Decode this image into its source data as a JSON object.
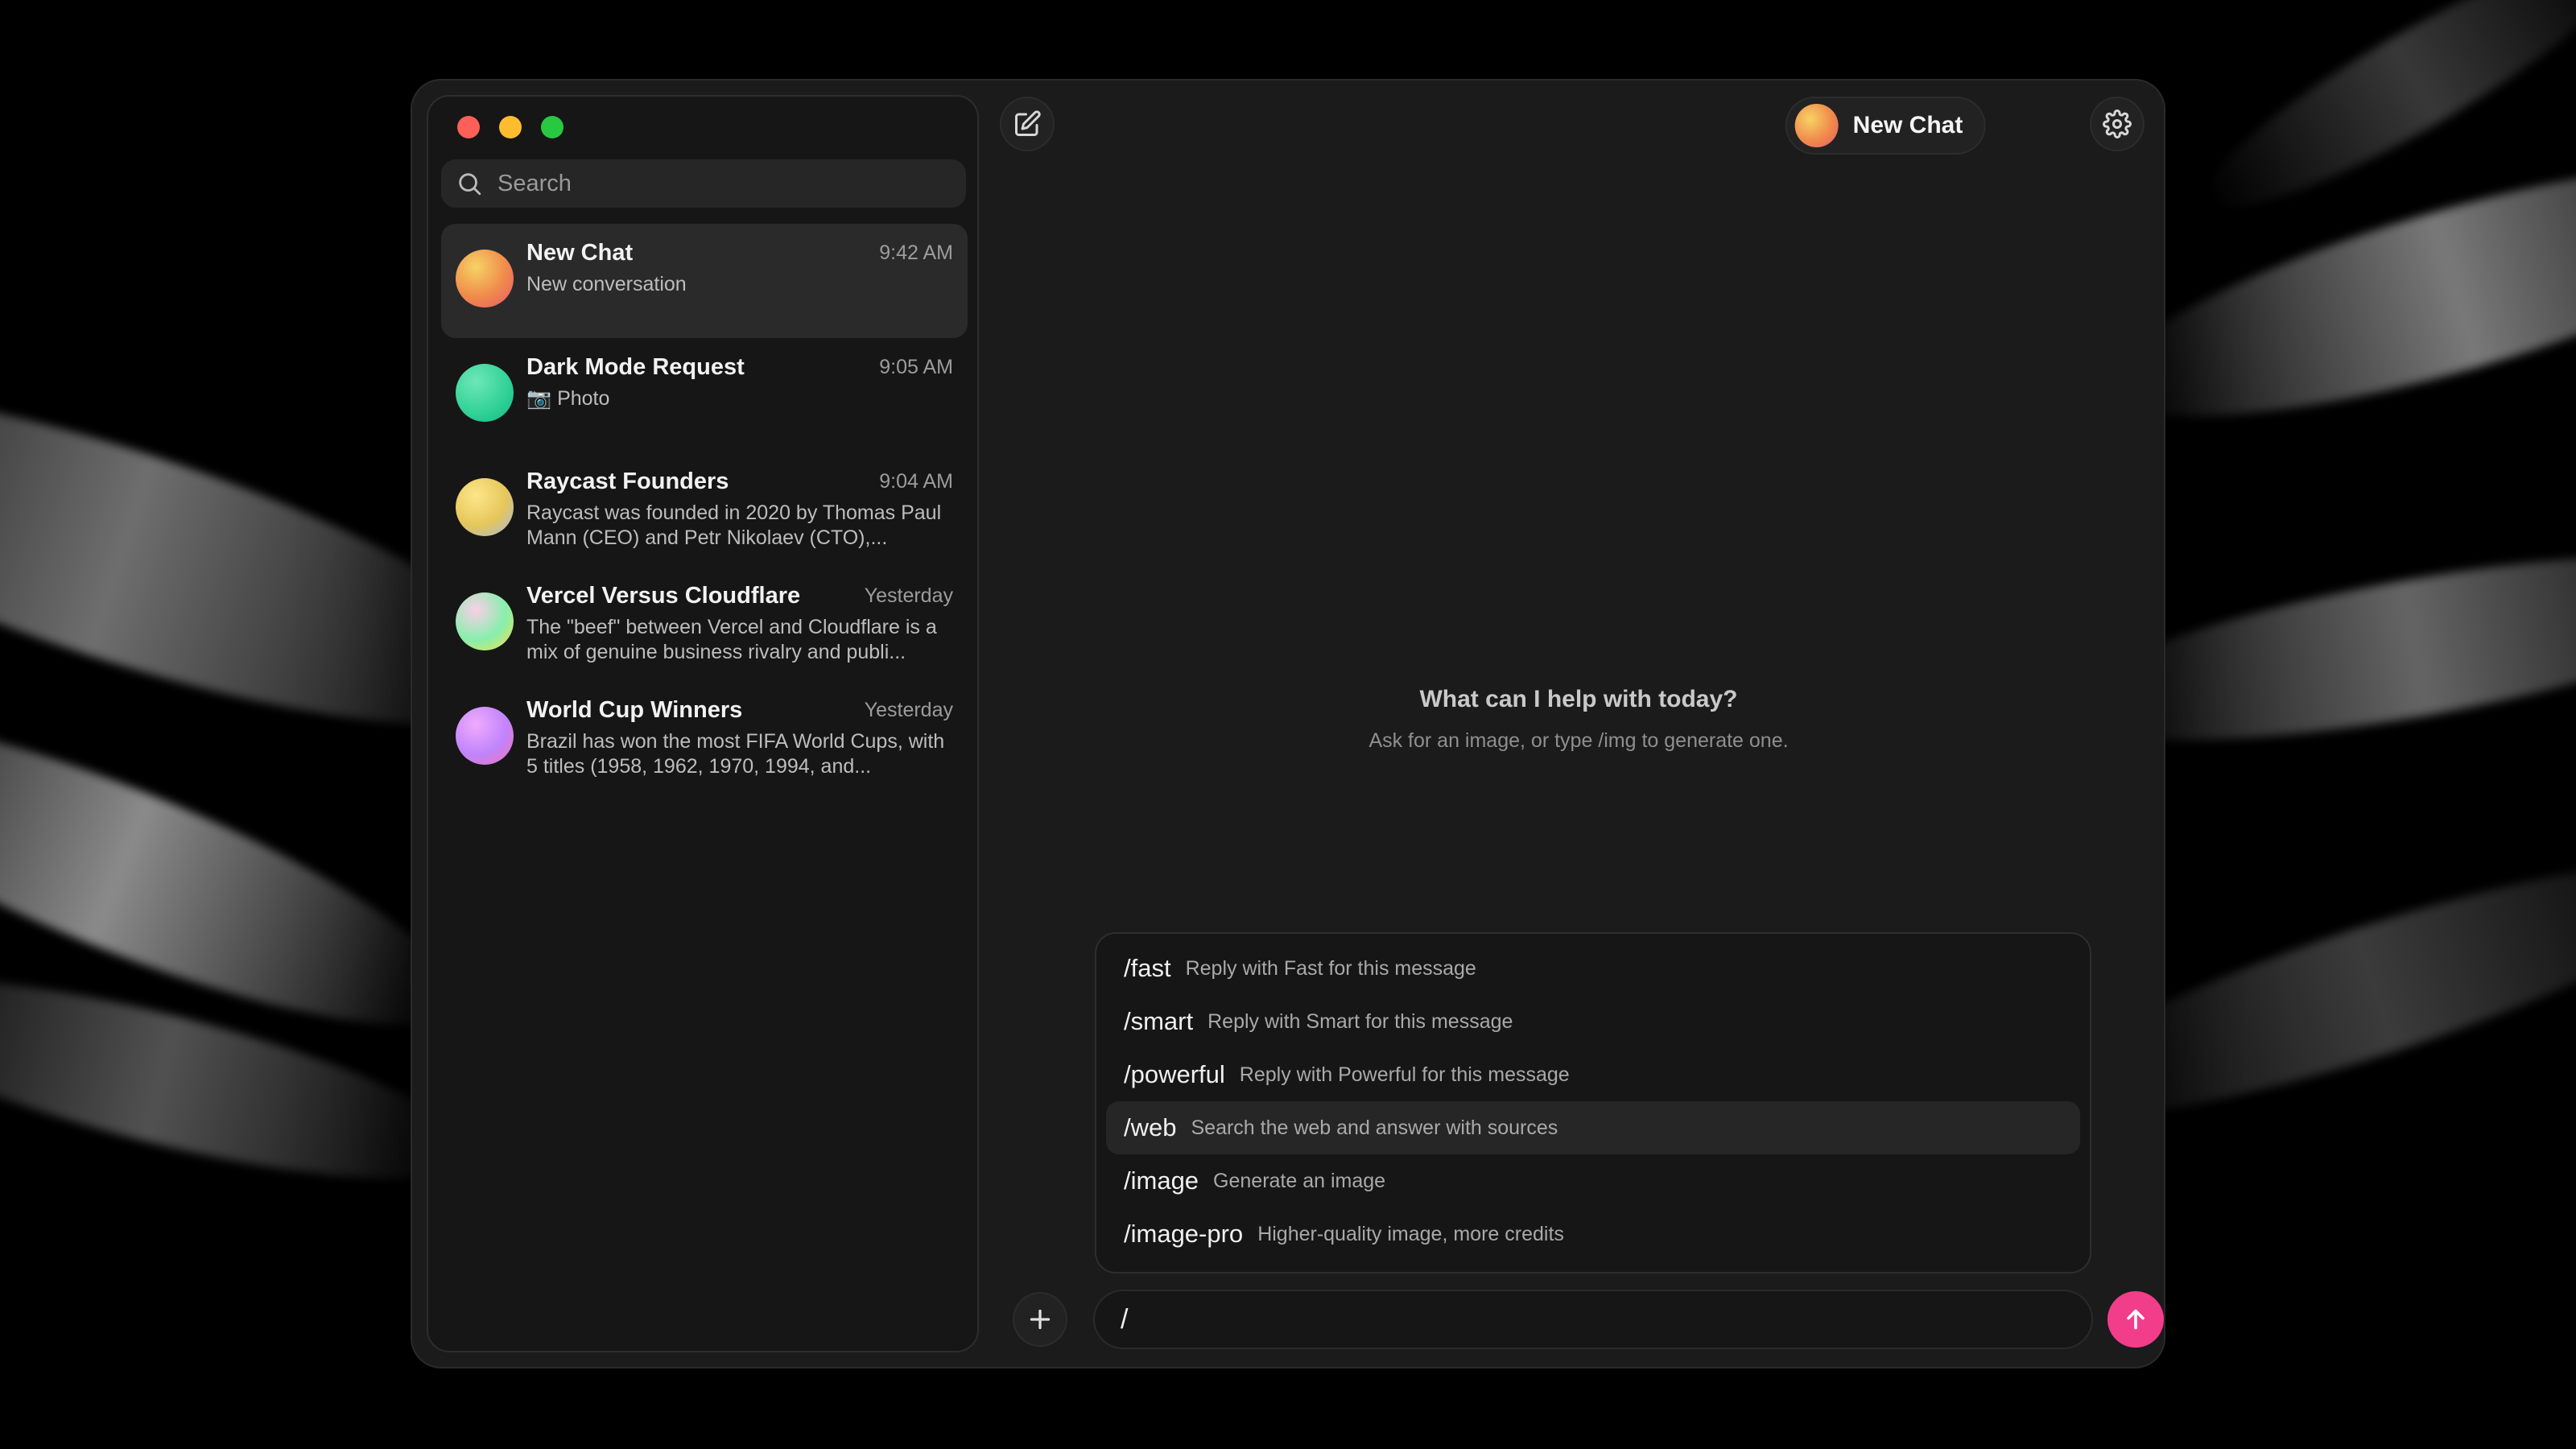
{
  "search": {
    "placeholder": "Search"
  },
  "chats": [
    {
      "title": "New Chat",
      "time": "9:42 AM",
      "preview": "New conversation",
      "active": true,
      "avatar_colors": [
        "#f6d365",
        "#f08a4b",
        "#e8566b"
      ]
    },
    {
      "title": "Dark Mode Request",
      "time": "9:05 AM",
      "preview": "📷 Photo",
      "active": false,
      "avatar_colors": [
        "#6ee7b7",
        "#34d399",
        "#10b981"
      ]
    },
    {
      "title": "Raycast Founders",
      "time": "9:04 AM",
      "preview": "Raycast was founded in 2020 by Thomas Paul Mann (CEO) and Petr Nikolaev (CTO),...",
      "active": false,
      "avatar_colors": [
        "#fde68a",
        "#e5c65a",
        "#a3b8e8"
      ]
    },
    {
      "title": "Vercel Versus Cloudflare",
      "time": "Yesterday",
      "preview": "The \"beef\" between Vercel and Cloudflare is a mix of genuine business rivalry and publi...",
      "active": false,
      "avatar_colors": [
        "#fbcfe8",
        "#86efac",
        "#fde047"
      ]
    },
    {
      "title": "World Cup Winners",
      "time": "Yesterday",
      "preview": "Brazil has won the most FIFA World Cups, with 5 titles (1958, 1962, 1970, 1994, and...",
      "active": false,
      "avatar_colors": [
        "#f0abfc",
        "#c084fc",
        "#f472b6"
      ]
    }
  ],
  "header": {
    "title": "New Chat"
  },
  "empty_state": {
    "heading": "What can I help with today?",
    "hint": "Ask for an image, or type /img to generate one."
  },
  "commands": [
    {
      "name": "/fast",
      "desc": "Reply with Fast for this message",
      "highlighted": false
    },
    {
      "name": "/smart",
      "desc": "Reply with Smart for this message",
      "highlighted": false
    },
    {
      "name": "/powerful",
      "desc": "Reply with Powerful for this message",
      "highlighted": false
    },
    {
      "name": "/web",
      "desc": "Search the web and answer with sources",
      "highlighted": true
    },
    {
      "name": "/image",
      "desc": "Generate an image",
      "highlighted": false
    },
    {
      "name": "/image-pro",
      "desc": "Higher-quality image, more credits",
      "highlighted": false
    }
  ],
  "composer": {
    "value": "/"
  },
  "colors": {
    "accent": "#f23d8a",
    "traffic_red": "#fe5f57",
    "traffic_yellow": "#febc2e",
    "traffic_green": "#28c840"
  },
  "icons": {
    "new_chat": "compose-icon",
    "settings": "gear-icon",
    "attach": "plus-icon",
    "send": "arrow-up-icon",
    "search": "search-icon"
  }
}
